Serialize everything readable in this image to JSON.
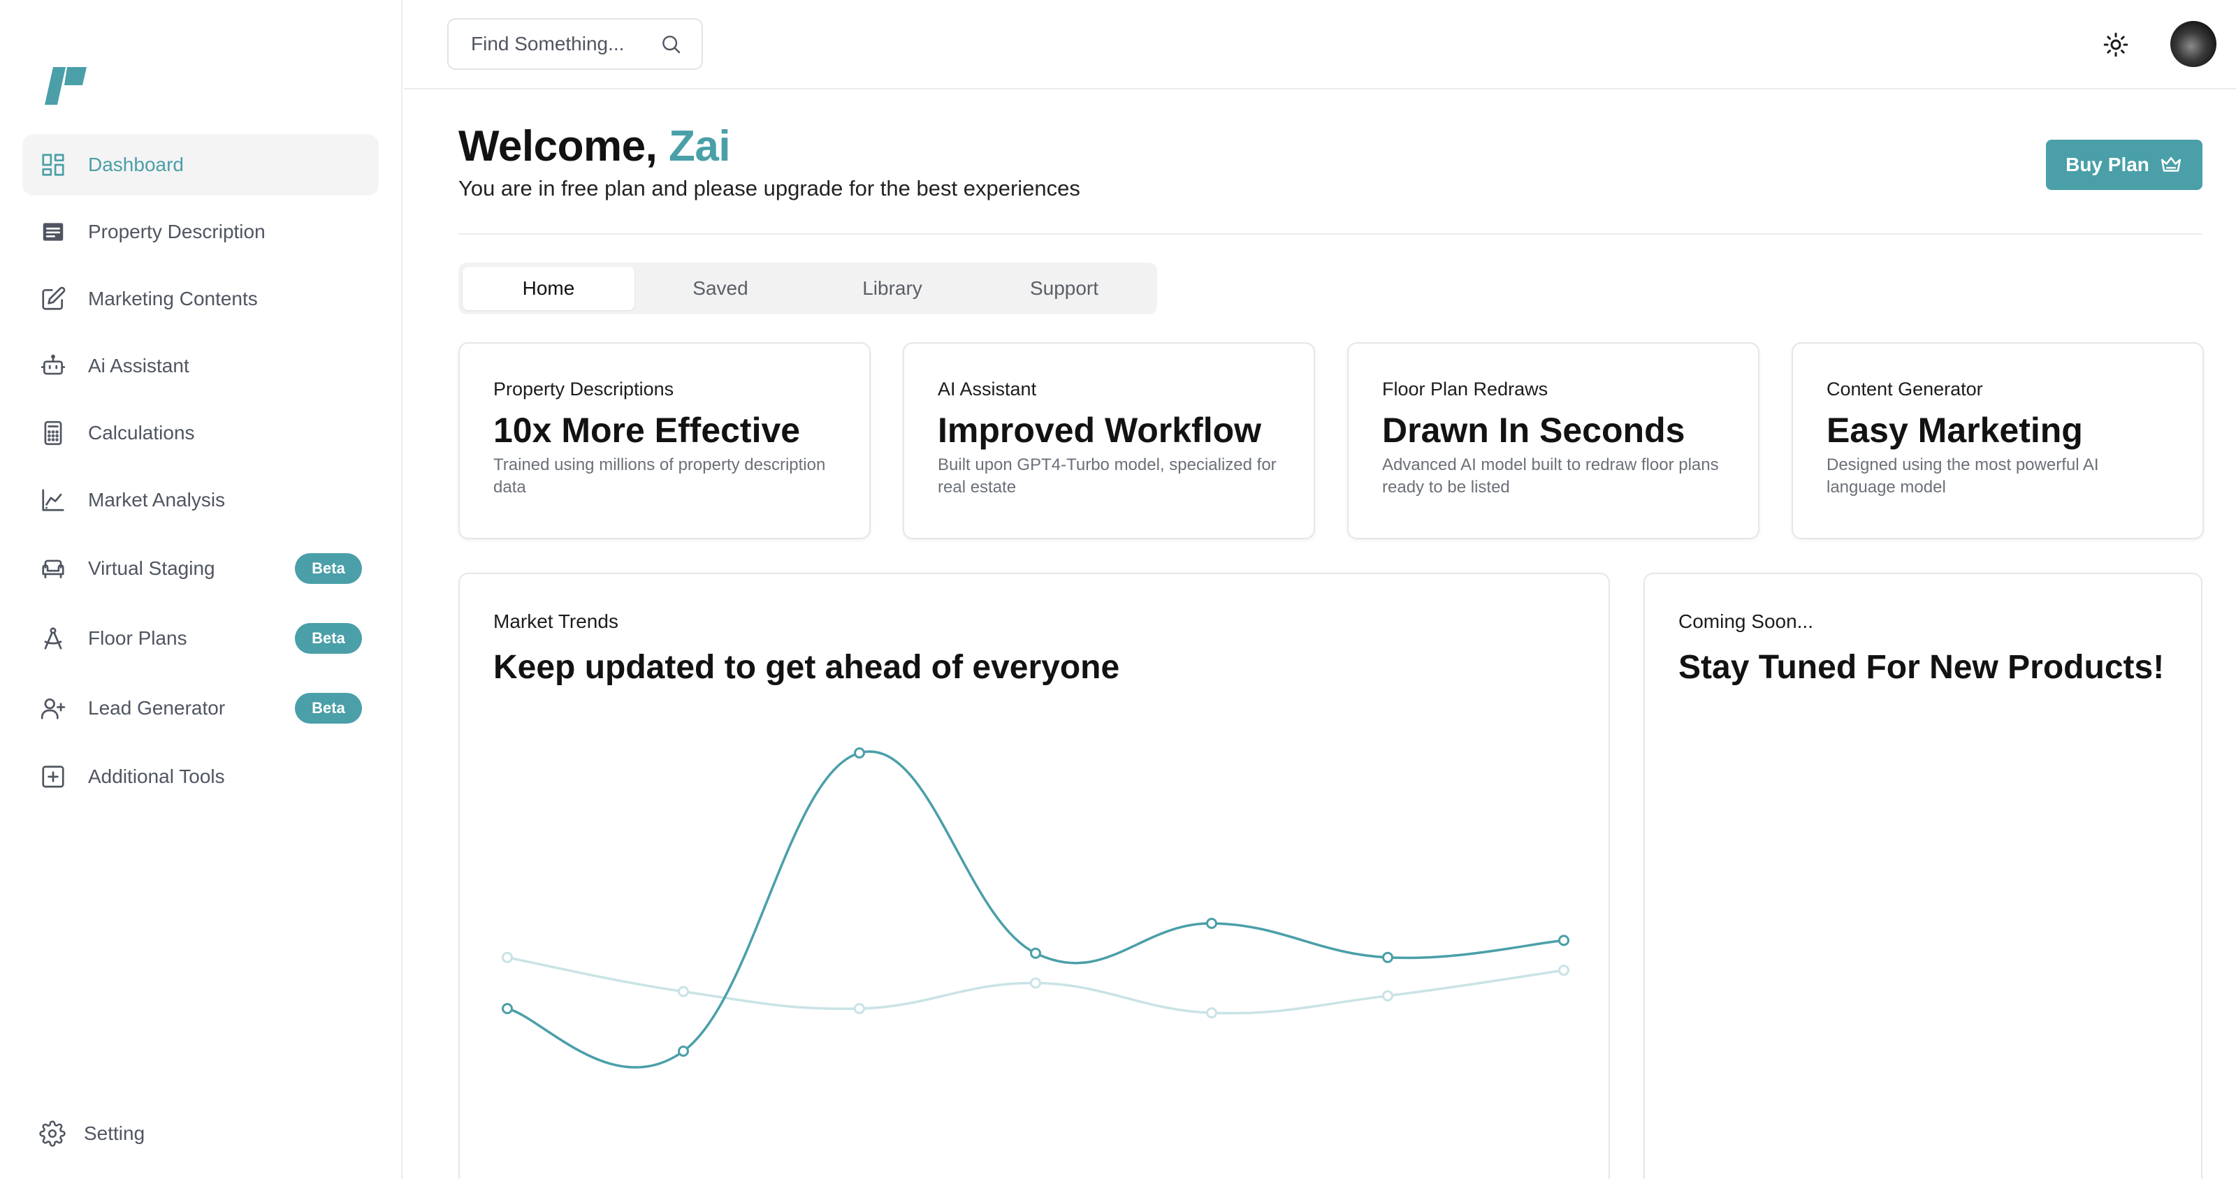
{
  "sidebar": {
    "items": [
      {
        "label": "Dashboard",
        "icon": "dashboard-icon",
        "active": true
      },
      {
        "label": "Property Description",
        "icon": "document-icon"
      },
      {
        "label": "Marketing Contents",
        "icon": "edit-icon"
      },
      {
        "label": "Ai Assistant",
        "icon": "robot-icon"
      },
      {
        "label": "Calculations",
        "icon": "calculator-icon"
      },
      {
        "label": "Market Analysis",
        "icon": "chart-icon"
      },
      {
        "label": "Virtual Staging",
        "icon": "sofa-icon",
        "badge": "Beta"
      },
      {
        "label": "Floor Plans",
        "icon": "compass-icon",
        "badge": "Beta"
      },
      {
        "label": "Lead Generator",
        "icon": "add-user-icon",
        "badge": "Beta"
      },
      {
        "label": "Additional Tools",
        "icon": "plus-square-icon"
      }
    ],
    "setting_label": "Setting"
  },
  "search": {
    "placeholder": "Find Something..."
  },
  "header": {
    "welcome_prefix": "Welcome, ",
    "user_name": "Zai",
    "subtitle": "You are in free plan and please upgrade for the best experiences",
    "buy_label": "Buy Plan"
  },
  "tabs": [
    "Home",
    "Saved",
    "Library",
    "Support"
  ],
  "cards": [
    {
      "label": "Property Descriptions",
      "title": "10x More Effective",
      "desc": "Trained using millions of property description data"
    },
    {
      "label": "AI Assistant",
      "title": "Improved Workflow",
      "desc": "Built upon GPT4-Turbo model, specialized for real estate"
    },
    {
      "label": "Floor Plan Redraws",
      "title": "Drawn In Seconds",
      "desc": "Advanced AI model built to redraw floor plans ready to be listed"
    },
    {
      "label": "Content Generator",
      "title": "Easy Marketing",
      "desc": "Designed using the most powerful AI language model"
    }
  ],
  "market": {
    "label": "Market Trends",
    "title": "Keep updated to get ahead of everyone"
  },
  "coming": {
    "label": "Coming Soon...",
    "title": "Stay Tuned For New Products!"
  },
  "colors": {
    "accent": "#4a9fa8",
    "accent_light": "#c9e3e6"
  },
  "chart_data": {
    "type": "line",
    "grid": false,
    "legend": false,
    "ylim": [
      0,
      100
    ],
    "series": [
      {
        "color": "#4a9fa8",
        "values": [
          40,
          30,
          100,
          53,
          60,
          52,
          56
        ]
      },
      {
        "color": "#c9e3e6",
        "values": [
          52,
          44,
          40,
          46,
          39,
          43,
          49
        ]
      }
    ]
  }
}
